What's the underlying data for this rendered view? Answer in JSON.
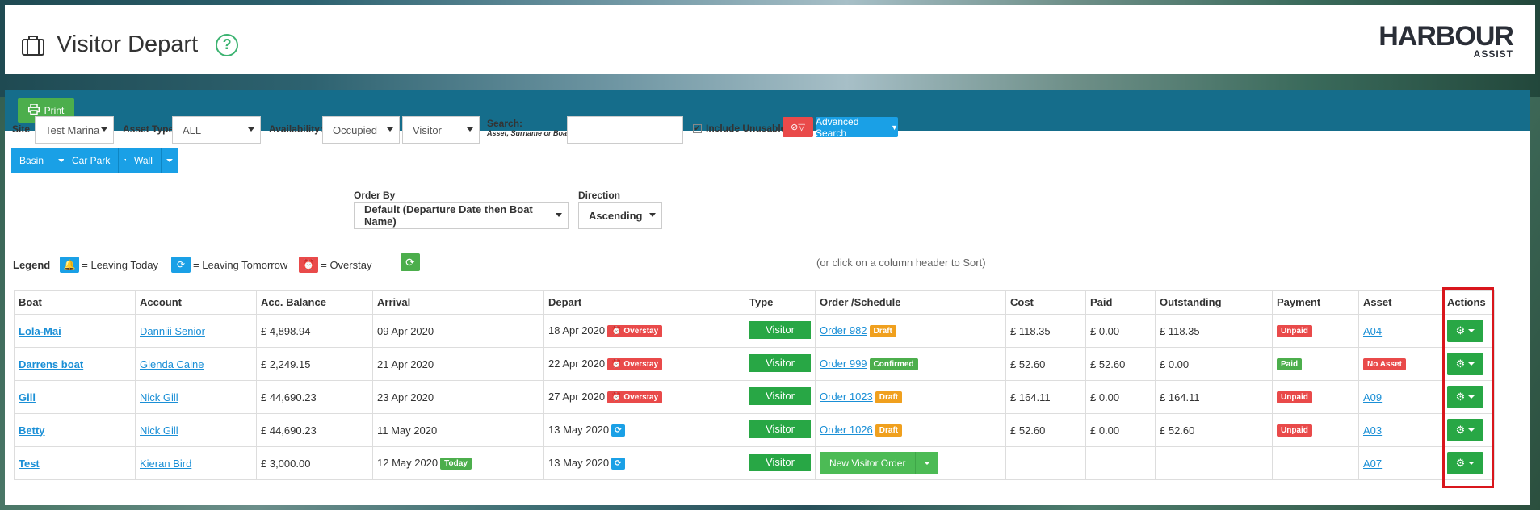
{
  "header": {
    "title": "Visitor Depart",
    "logo_main": "HARBOUR",
    "logo_sub": "ASSIST"
  },
  "toolbar": {
    "print_label": "Print"
  },
  "filters": {
    "site_label": "Site",
    "site_value": "Test Marina",
    "asset_type_label": "Asset Type",
    "asset_type_value": "ALL",
    "availability_label": "Availability:",
    "availability_value": "Occupied",
    "availability_type_value": "Visitor",
    "search_label": "Search:",
    "search_hint": "Asset, Surname or Boat",
    "search_value": "",
    "include_unusable_label": "Include Unusable",
    "include_unusable_checked": true,
    "advanced_search_label": "Advanced Search"
  },
  "quick_buttons": [
    "Basin",
    "Car Park",
    "Wall"
  ],
  "legend": {
    "title": "Legend",
    "leaving_today": "= Leaving Today",
    "leaving_tomorrow": "= Leaving Tomorrow",
    "overstay": "= Overstay"
  },
  "order_by": {
    "label": "Order By",
    "value": "Default (Departure Date then Boat Name)"
  },
  "direction": {
    "label": "Direction",
    "value": "Ascending",
    "hint": "(or click on a column header to Sort)"
  },
  "columns": [
    "Boat",
    "Account",
    "Acc. Balance",
    "Arrival",
    "Depart",
    "Type",
    "Order /Schedule",
    "Cost",
    "Paid",
    "Outstanding",
    "Payment",
    "Asset",
    "Actions"
  ],
  "rows": [
    {
      "boat": "Lola-Mai",
      "account": "Danniii Senior",
      "balance": "£ 4,898.94",
      "arrival": "09 Apr 2020",
      "arrival_badge": "",
      "depart": "18 Apr 2020",
      "depart_badge": "Overstay",
      "depart_icon": "",
      "type": "Visitor",
      "order": "Order 982",
      "order_badge": "Draft",
      "cost": "£ 118.35",
      "paid": "£ 0.00",
      "outstanding": "£ 118.35",
      "outstanding_negative": true,
      "payment": "Unpaid",
      "asset": "A04",
      "asset_badge": ""
    },
    {
      "boat": "Darrens boat",
      "account": "Glenda Caine",
      "balance": "£ 2,249.15",
      "arrival": "21 Apr 2020",
      "arrival_badge": "",
      "depart": "22 Apr 2020",
      "depart_badge": "Overstay",
      "depart_icon": "",
      "type": "Visitor",
      "order": "Order 999",
      "order_badge": "Confirmed",
      "cost": "£ 52.60",
      "paid": "£ 52.60",
      "outstanding": "£ 0.00",
      "outstanding_negative": false,
      "payment": "Paid",
      "asset": "",
      "asset_badge": "No Asset"
    },
    {
      "boat": "Gill",
      "account": "Nick Gill",
      "balance": "£ 44,690.23",
      "arrival": "23 Apr 2020",
      "arrival_badge": "",
      "depart": "27 Apr 2020",
      "depart_badge": "Overstay",
      "depart_icon": "",
      "type": "Visitor",
      "order": "Order 1023",
      "order_badge": "Draft",
      "cost": "£ 164.11",
      "paid": "£ 0.00",
      "outstanding": "£ 164.11",
      "outstanding_negative": true,
      "payment": "Unpaid",
      "asset": "A09",
      "asset_badge": ""
    },
    {
      "boat": "Betty",
      "account": "Nick Gill",
      "balance": "£ 44,690.23",
      "arrival": "11 May 2020",
      "arrival_badge": "",
      "depart": "13 May 2020",
      "depart_badge": "",
      "depart_icon": "leaving-tomorrow",
      "type": "Visitor",
      "order": "Order 1026",
      "order_badge": "Draft",
      "cost": "£ 52.60",
      "paid": "£ 0.00",
      "outstanding": "£ 52.60",
      "outstanding_negative": true,
      "payment": "Unpaid",
      "asset": "A03",
      "asset_badge": ""
    },
    {
      "boat": "Test",
      "account": "Kieran Bird",
      "balance": "£ 3,000.00",
      "arrival": "12 May 2020",
      "arrival_badge": "Today",
      "depart": "13 May 2020",
      "depart_badge": "",
      "depart_icon": "leaving-tomorrow",
      "type": "Visitor",
      "order": "",
      "order_badge": "",
      "new_order_label": "New Visitor Order",
      "cost": "",
      "paid": "",
      "outstanding": "",
      "outstanding_negative": false,
      "payment": "",
      "asset": "A07",
      "asset_badge": ""
    }
  ],
  "colors": {
    "teal_bar": "#156d8b",
    "green": "#28a745",
    "red": "#e94a4a",
    "blue": "#1aa0e6",
    "orange": "#f0a01e",
    "highlight": "#d9161c"
  }
}
